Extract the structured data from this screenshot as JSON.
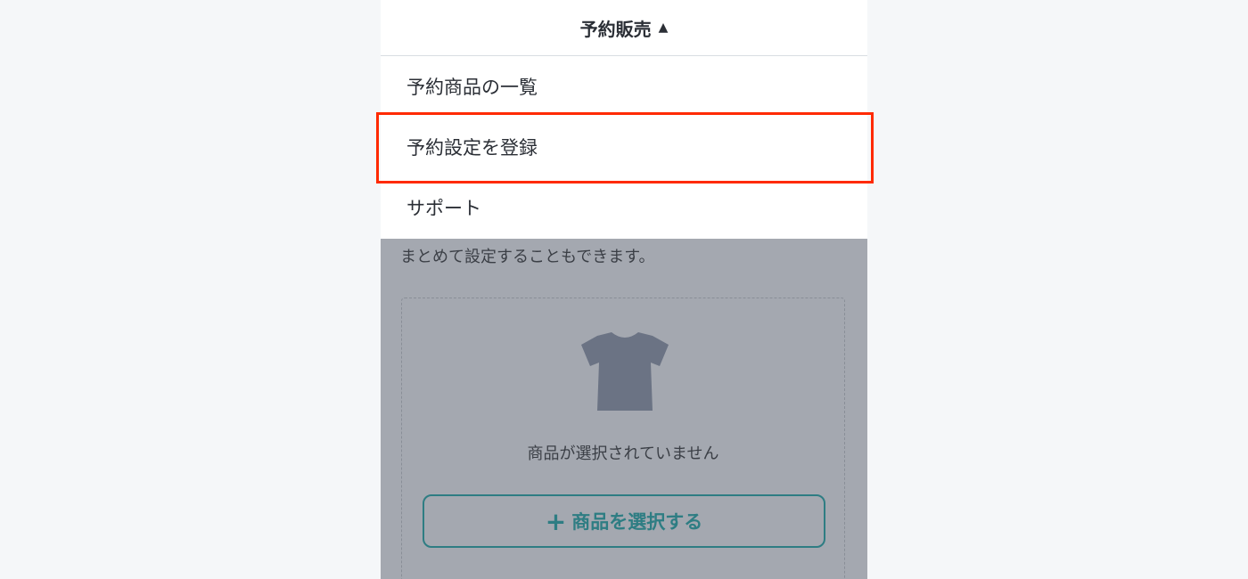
{
  "header": {
    "title": "予約販売",
    "caret": "▲"
  },
  "menu": {
    "items": [
      {
        "label": "予約商品の一覧"
      },
      {
        "label": "予約設定を登録"
      },
      {
        "label": "サポート"
      }
    ]
  },
  "background_page": {
    "description": "まとめて設定することもできます。",
    "empty_message": "商品が選択されていません",
    "select_button_label": "商品を選択する",
    "select_button_icon": "+"
  },
  "colors": {
    "highlight": "#ff2a00",
    "accent": "#2e7d83",
    "overlay": "#a4a8b0"
  }
}
